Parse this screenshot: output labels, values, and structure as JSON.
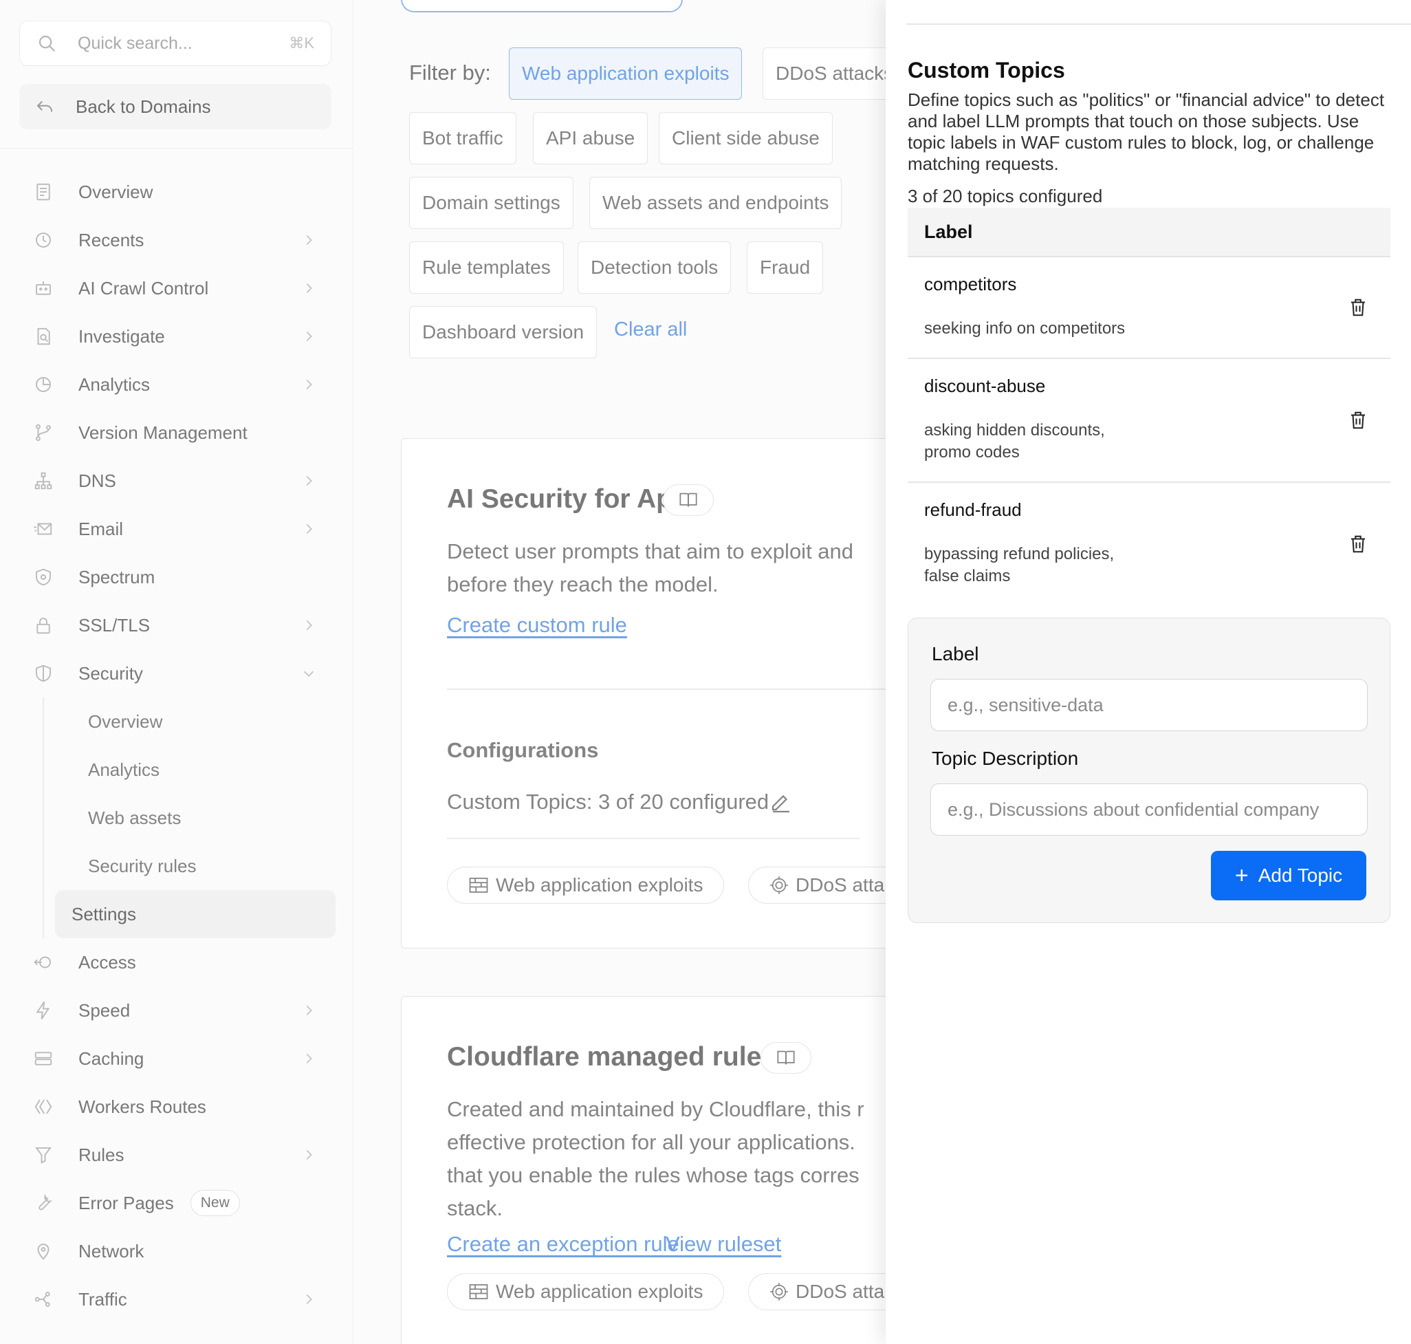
{
  "sidebar": {
    "search": {
      "placeholder": "Quick search...",
      "shortcut": "⌘K"
    },
    "back_label": "Back to Domains",
    "items": [
      {
        "label": "Overview",
        "icon": "document-icon",
        "chevron": false
      },
      {
        "label": "Recents",
        "icon": "clock-icon",
        "chevron": true
      },
      {
        "label": "AI Crawl Control",
        "icon": "robot-icon",
        "chevron": true
      },
      {
        "label": "Investigate",
        "icon": "investigate-icon",
        "chevron": true
      },
      {
        "label": "Analytics",
        "icon": "pie-chart-icon",
        "chevron": true
      },
      {
        "label": "Version Management",
        "icon": "branch-icon",
        "chevron": false
      },
      {
        "label": "DNS",
        "icon": "network-tree-icon",
        "chevron": true
      },
      {
        "label": "Email",
        "icon": "envelope-icon",
        "chevron": true
      },
      {
        "label": "Spectrum",
        "icon": "shield-gear-icon",
        "chevron": false
      },
      {
        "label": "SSL/TLS",
        "icon": "lock-icon",
        "chevron": true
      },
      {
        "label": "Security",
        "icon": "shield-icon",
        "chevron": "down"
      }
    ],
    "security_sub": [
      {
        "label": "Overview",
        "active": false
      },
      {
        "label": "Analytics",
        "active": false
      },
      {
        "label": "Web assets",
        "active": false
      },
      {
        "label": "Security rules",
        "active": false
      },
      {
        "label": "Settings",
        "active": true
      }
    ],
    "items_after": [
      {
        "label": "Access",
        "icon": "access-icon",
        "chevron": false
      },
      {
        "label": "Speed",
        "icon": "lightning-icon",
        "chevron": true
      },
      {
        "label": "Caching",
        "icon": "server-icon",
        "chevron": true
      },
      {
        "label": "Workers Routes",
        "icon": "workers-icon",
        "chevron": false
      },
      {
        "label": "Rules",
        "icon": "funnel-icon",
        "chevron": true
      },
      {
        "label": "Error Pages",
        "icon": "wrench-icon",
        "chevron": false,
        "badge": "New"
      },
      {
        "label": "Network",
        "icon": "location-pin-icon",
        "chevron": false
      },
      {
        "label": "Traffic",
        "icon": "traffic-icon",
        "chevron": true
      }
    ]
  },
  "main": {
    "filter_label": "Filter by:",
    "filters": [
      {
        "label": "Web application exploits",
        "active": true
      },
      {
        "label": "DDoS attacks",
        "active": false
      },
      {
        "label": "Bot traffic",
        "active": false
      },
      {
        "label": "API abuse",
        "active": false
      },
      {
        "label": "Client side abuse",
        "active": false
      },
      {
        "label": "Domain settings",
        "active": false
      },
      {
        "label": "Web assets and endpoints",
        "active": false
      },
      {
        "label": "Rule templates",
        "active": false
      },
      {
        "label": "Detection tools",
        "active": false
      },
      {
        "label": "Fraud",
        "active": false
      },
      {
        "label": "Dashboard version",
        "active": false
      }
    ],
    "clear_all": "Clear all",
    "card1": {
      "title": "AI Security for Apps",
      "desc_line1": "Detect user prompts that aim to exploit and",
      "desc_line2": "before they reach the model.",
      "link": "Create custom rule",
      "config_title": "Configurations",
      "config_line": "Custom Topics: 3 of 20 configured",
      "tag1": "Web application exploits",
      "tag2": "DDoS atta"
    },
    "card2": {
      "title": "Cloudflare managed ruleset",
      "desc_line1": "Created and maintained by Cloudflare, this r",
      "desc_line2": "effective protection for all your applications.",
      "desc_line3": "that you enable the rules whose tags corres",
      "desc_line4": "stack.",
      "link1": "Create an exception rule",
      "link2": "View ruleset",
      "tag1": "Web application exploits",
      "tag2": "DDoS atta"
    }
  },
  "drawer": {
    "title": "Custom Topics",
    "description": "Define topics such as \"politics\" or \"financial advice\" to detect and label LLM prompts that touch on those subjects. Use topic labels in WAF custom rules to block, log, or challenge matching requests.",
    "count": "3 of 20 topics configured",
    "table_header": "Label",
    "topics": [
      {
        "label": "competitors",
        "description": "seeking info on competitors"
      },
      {
        "label": "discount-abuse",
        "description": "asking hidden discounts,\npromo codes"
      },
      {
        "label": "refund-fraud",
        "description": "bypassing refund policies,\nfalse claims"
      }
    ],
    "form": {
      "label_title": "Label",
      "label_placeholder": "e.g., sensitive-data",
      "desc_title": "Topic Description",
      "desc_placeholder": "e.g., Discussions about confidential company",
      "submit": "Add Topic"
    },
    "colors": {
      "primary": "#0b6cf5",
      "link": "#3b7ee0"
    }
  }
}
